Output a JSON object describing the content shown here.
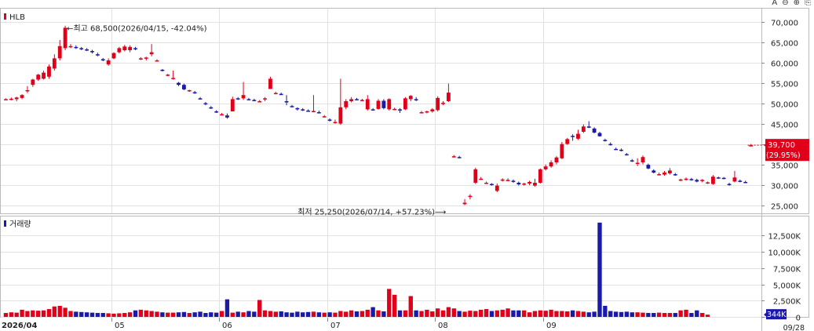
{
  "toolbar": {
    "zoom_label": "A",
    "zoom_out": "⊖",
    "zoom_in": "⊕",
    "page": "⎘"
  },
  "colors": {
    "up": "#e0001a",
    "down": "#1a1aa8",
    "grid": "#e2e2e2",
    "axis_text": "#222222",
    "current": "#e0001a"
  },
  "chart_data": [
    {
      "type": "candlestick",
      "title": "HLB",
      "y_ticks": [
        "70,000",
        "65,000",
        "60,000",
        "55,000",
        "50,000",
        "45,000",
        "40,000",
        "35,000",
        "30,000",
        "25,000"
      ],
      "y_tick_values": [
        70000,
        65000,
        60000,
        55000,
        50000,
        45000,
        40000,
        35000,
        30000,
        25000
      ],
      "ylim": [
        23000,
        73000
      ],
      "current_price": "39,700",
      "current_change": "(29.95%)",
      "current_value": 39700,
      "annotations": [
        {
          "text": "←최고 68,500(2026/04/15, -42.04%)",
          "value": 68500,
          "index": 11
        },
        {
          "text": "최저 25,250(2026/07/14, +57.23%)⟶",
          "value": 25250,
          "index": 82
        }
      ],
      "candles": [
        [
          51000,
          51200,
          50800,
          51000
        ],
        [
          51000,
          51400,
          50700,
          51100
        ],
        [
          51000,
          51600,
          50500,
          51400
        ],
        [
          51300,
          52200,
          51000,
          52000
        ],
        [
          53000,
          54200,
          52500,
          53200
        ],
        [
          54500,
          56000,
          54000,
          55800
        ],
        [
          55800,
          57200,
          55500,
          57000
        ],
        [
          56000,
          58000,
          55800,
          57500
        ],
        [
          56500,
          59500,
          56000,
          59000
        ],
        [
          58500,
          62000,
          58000,
          61000
        ],
        [
          61000,
          65500,
          60500,
          64000
        ],
        [
          63500,
          69000,
          63000,
          68500
        ],
        [
          64000,
          64500,
          63500,
          64000
        ],
        [
          63800,
          64200,
          63300,
          63600
        ],
        [
          63500,
          63800,
          63000,
          63300
        ],
        [
          63200,
          63500,
          62800,
          63000
        ],
        [
          62800,
          63100,
          62200,
          62500
        ],
        [
          62000,
          62400,
          61500,
          61800
        ],
        [
          60800,
          61100,
          60300,
          60500
        ],
        [
          59500,
          61000,
          59200,
          60500
        ],
        [
          61000,
          62500,
          60800,
          62300
        ],
        [
          62500,
          63800,
          62200,
          63500
        ],
        [
          63000,
          64300,
          62700,
          63900
        ],
        [
          63000,
          64200,
          62500,
          63800
        ],
        [
          63500,
          63800,
          63000,
          63300
        ],
        [
          61000,
          61300,
          60600,
          61000
        ],
        [
          61000,
          61400,
          60500,
          61200
        ],
        [
          62000,
          64500,
          61500,
          62500
        ],
        [
          60500,
          60800,
          60200,
          60500
        ],
        [
          58200,
          58400,
          57800,
          58000
        ],
        [
          57000,
          57200,
          56600,
          57000
        ],
        [
          56000,
          58000,
          55800,
          56200
        ],
        [
          55000,
          55200,
          54200,
          54500
        ],
        [
          54500,
          54800,
          53200,
          53400
        ],
        [
          53000,
          53300,
          52800,
          53200
        ],
        [
          52700,
          53000,
          52300,
          52500
        ],
        [
          51200,
          51500,
          50900,
          51000
        ],
        [
          50000,
          50300,
          49500,
          49800
        ],
        [
          49000,
          49300,
          48600,
          48700
        ],
        [
          48000,
          48300,
          47600,
          47800
        ],
        [
          47300,
          47600,
          47000,
          47300
        ],
        [
          47000,
          47500,
          46200,
          46500
        ],
        [
          48000,
          51600,
          48000,
          51000
        ],
        [
          51200,
          51500,
          50800,
          51000
        ],
        [
          51200,
          55200,
          50800,
          52000
        ],
        [
          51000,
          51300,
          50700,
          50900
        ],
        [
          50800,
          51100,
          50500,
          50700
        ],
        [
          50500,
          50800,
          50200,
          50500
        ],
        [
          51000,
          51500,
          50500,
          51200
        ],
        [
          53500,
          56500,
          53500,
          56000
        ],
        [
          52500,
          52800,
          52200,
          52500
        ],
        [
          52300,
          52600,
          52000,
          52200
        ],
        [
          50500,
          52000,
          49500,
          50200
        ],
        [
          49300,
          49600,
          49000,
          49200
        ],
        [
          48800,
          49000,
          48200,
          48500
        ],
        [
          48500,
          48800,
          48100,
          48400
        ],
        [
          48200,
          48500,
          47900,
          48100
        ],
        [
          48000,
          52000,
          47800,
          48100
        ],
        [
          47800,
          48200,
          47500,
          47700
        ],
        [
          46800,
          47100,
          46500,
          46800
        ],
        [
          46000,
          46300,
          45500,
          45800
        ],
        [
          45200,
          46000,
          45000,
          45400
        ],
        [
          45000,
          56000,
          44700,
          49000
        ],
        [
          49000,
          51000,
          48500,
          50500
        ],
        [
          50500,
          51500,
          50200,
          51000
        ],
        [
          51000,
          51300,
          50700,
          50900
        ],
        [
          50800,
          51100,
          50500,
          50800
        ],
        [
          48500,
          52000,
          48200,
          51000
        ],
        [
          48500,
          48800,
          48200,
          48400
        ],
        [
          48600,
          51000,
          48400,
          50600
        ],
        [
          50600,
          51000,
          48500,
          48800
        ],
        [
          48500,
          51200,
          48200,
          51000
        ],
        [
          48600,
          48900,
          48300,
          48600
        ],
        [
          48500,
          48800,
          47600,
          48200
        ],
        [
          48500,
          51500,
          48300,
          51200
        ],
        [
          51000,
          52000,
          50500,
          51800
        ],
        [
          51000,
          51500,
          50500,
          50800
        ],
        [
          47800,
          48100,
          47500,
          47800
        ],
        [
          47800,
          48200,
          47500,
          48000
        ],
        [
          48000,
          48800,
          47700,
          48500
        ],
        [
          48300,
          51700,
          48000,
          51300
        ],
        [
          49800,
          50500,
          49500,
          50100
        ],
        [
          50500,
          54800,
          50300,
          52600
        ],
        [
          37000,
          37300,
          36700,
          37000
        ],
        [
          36800,
          37100,
          36500,
          36700
        ],
        [
          25250,
          26500,
          25000,
          25600
        ],
        [
          27000,
          27700,
          26400,
          27300
        ],
        [
          30500,
          34200,
          30200,
          33800
        ],
        [
          31500,
          31900,
          31200,
          31500
        ],
        [
          30500,
          30800,
          30200,
          30500
        ],
        [
          30200,
          30400,
          29800,
          30000
        ],
        [
          28500,
          30300,
          28200,
          29800
        ],
        [
          31000,
          31600,
          30800,
          31300
        ],
        [
          31200,
          31600,
          30900,
          31200
        ],
        [
          31000,
          31300,
          30500,
          30800
        ],
        [
          30500,
          30800,
          29800,
          30100
        ],
        [
          30200,
          30500,
          29800,
          30300
        ],
        [
          30300,
          31000,
          29900,
          30700
        ],
        [
          29800,
          31500,
          29500,
          30500
        ],
        [
          30500,
          34000,
          30300,
          33800
        ],
        [
          33800,
          35000,
          33500,
          34500
        ],
        [
          34500,
          36000,
          34200,
          35500
        ],
        [
          35500,
          37000,
          35000,
          36700
        ],
        [
          36500,
          40500,
          36300,
          40000
        ],
        [
          40000,
          41500,
          39800,
          41200
        ],
        [
          42000,
          42400,
          40800,
          41800
        ],
        [
          41300,
          43500,
          41000,
          42500
        ],
        [
          43000,
          44800,
          42700,
          44300
        ],
        [
          44300,
          45600,
          43900,
          44000
        ],
        [
          43800,
          44100,
          42600,
          42800
        ],
        [
          42700,
          43000,
          41800,
          41900
        ],
        [
          41000,
          41300,
          40600,
          40800
        ],
        [
          40000,
          40400,
          39600,
          39800
        ],
        [
          38800,
          39100,
          38500,
          38700
        ],
        [
          38600,
          38900,
          38200,
          38500
        ],
        [
          37500,
          37800,
          37200,
          37400
        ],
        [
          36000,
          36300,
          35600,
          35800
        ],
        [
          35200,
          36500,
          34600,
          35400
        ],
        [
          35500,
          37200,
          35000,
          36800
        ],
        [
          34900,
          35200,
          33800,
          34000
        ],
        [
          33500,
          33800,
          32800,
          33000
        ],
        [
          32600,
          33000,
          32300,
          32600
        ],
        [
          32500,
          33400,
          32200,
          33000
        ],
        [
          32800,
          34100,
          32500,
          33500
        ],
        [
          32600,
          32900,
          32200,
          32500
        ],
        [
          31200,
          31500,
          30900,
          31300
        ],
        [
          31400,
          31800,
          31000,
          31500
        ],
        [
          31400,
          31700,
          31000,
          31200
        ],
        [
          31200,
          31500,
          30600,
          30800
        ],
        [
          31000,
          31400,
          30600,
          31200
        ],
        [
          30500,
          30800,
          30200,
          30600
        ],
        [
          30200,
          32400,
          30000,
          32000
        ],
        [
          31800,
          32000,
          31500,
          31600
        ],
        [
          31700,
          31900,
          31400,
          31500
        ],
        [
          30200,
          30500,
          29800,
          30100
        ],
        [
          30800,
          33400,
          30600,
          31800
        ],
        [
          31000,
          31300,
          30600,
          30800
        ],
        [
          30700,
          31000,
          30400,
          30600
        ],
        [
          39700,
          40000,
          39400,
          39700
        ]
      ],
      "x_labels": [
        {
          "label": "2026/04",
          "index": 0
        },
        {
          "label": "05",
          "index": 20
        },
        {
          "label": "06",
          "index": 40
        },
        {
          "label": "07",
          "index": 60
        },
        {
          "label": "08",
          "index": 80
        },
        {
          "label": "09",
          "index": 100
        }
      ]
    },
    {
      "type": "bar",
      "title": "거래량",
      "y_ticks": [
        "12,500K",
        "10,000K",
        "7,500K",
        "5,000K",
        "2,500K",
        "0"
      ],
      "y_tick_values": [
        12500,
        10000,
        7500,
        5000,
        2500,
        0
      ],
      "ylim": [
        0,
        15200
      ],
      "current_volume": "344K",
      "current_value": 344,
      "end_date": "09/28",
      "volumes": [
        600,
        700,
        650,
        1100,
        900,
        1000,
        950,
        1000,
        1200,
        1600,
        1700,
        1400,
        900,
        800,
        750,
        700,
        650,
        600,
        600,
        550,
        500,
        550,
        600,
        700,
        1000,
        1100,
        1000,
        900,
        800,
        700,
        650,
        650,
        700,
        750,
        600,
        700,
        800,
        600,
        700,
        650,
        900,
        2700,
        650,
        800,
        700,
        900,
        800,
        2600,
        1000,
        900,
        800,
        850,
        700,
        650,
        800,
        700,
        750,
        800,
        700,
        650,
        700,
        650,
        900,
        800,
        1000,
        850,
        900,
        1100,
        1500,
        1000,
        850,
        4300,
        3400,
        1000,
        1000,
        3200,
        1000,
        900,
        1100,
        850,
        1300,
        1000,
        1500,
        1300,
        900,
        800,
        950,
        900,
        1100,
        1200,
        900,
        1000,
        1100,
        1300,
        1000,
        1000,
        1000,
        700,
        900,
        1000,
        950,
        1100,
        900,
        900,
        850,
        1000,
        900,
        800,
        700,
        800,
        14500,
        1700,
        900,
        800,
        750,
        800,
        700,
        700,
        650,
        600,
        600,
        650,
        600,
        600,
        600,
        1000,
        1100,
        600,
        1000,
        600,
        344
      ]
    }
  ]
}
